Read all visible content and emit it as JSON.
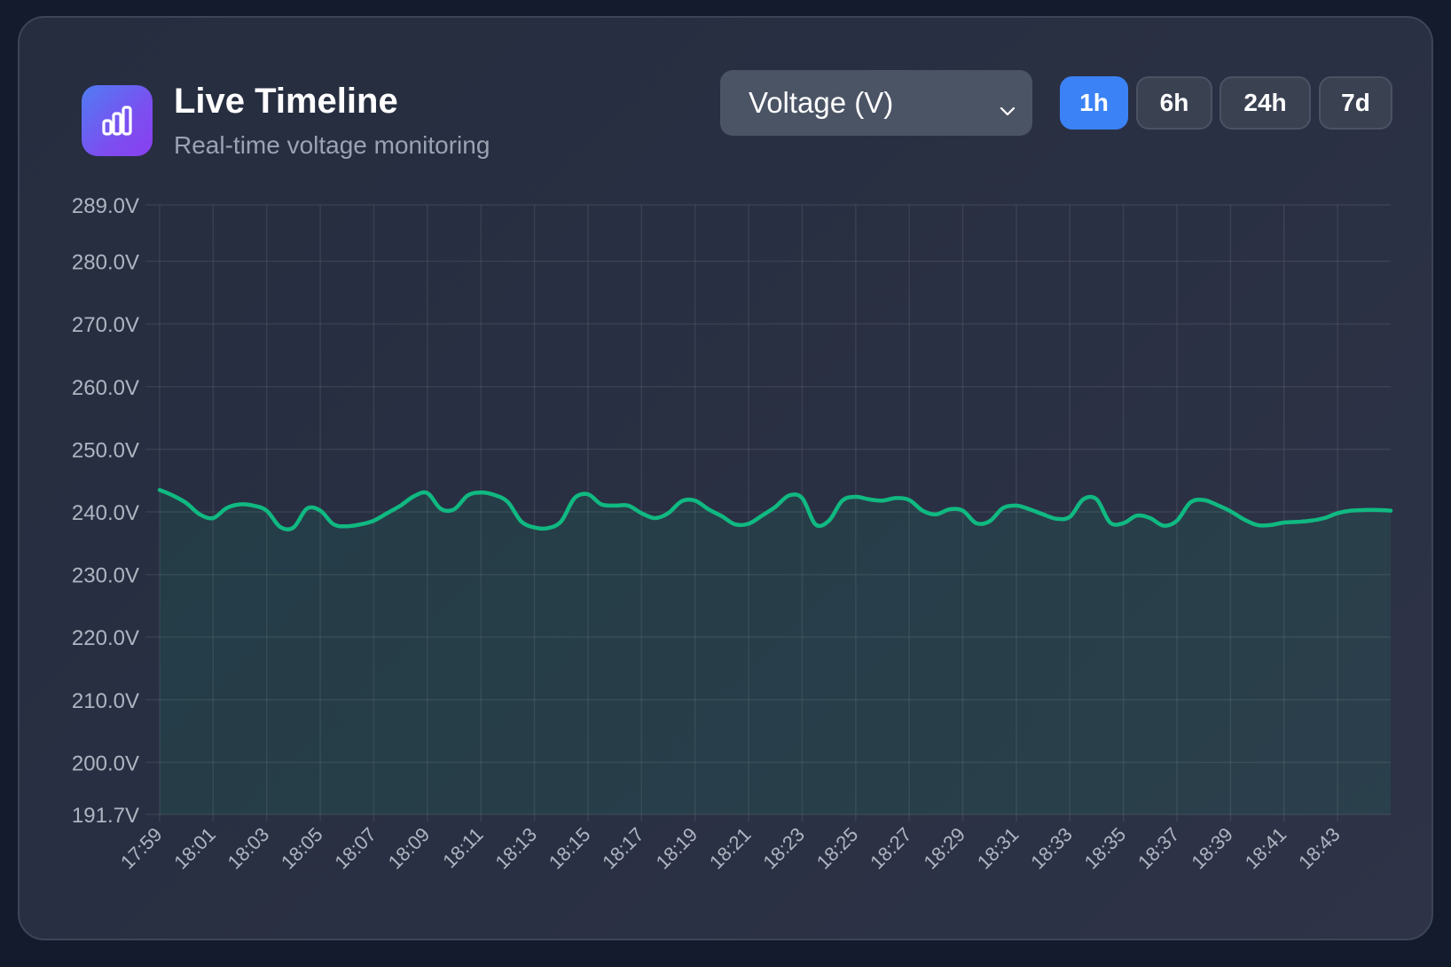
{
  "header": {
    "title": "Live Timeline",
    "subtitle": "Real-time voltage monitoring",
    "icon": "bar-chart-icon"
  },
  "metric_select": {
    "selected": "Voltage (V)"
  },
  "time_ranges": [
    {
      "label": "1h",
      "active": true
    },
    {
      "label": "6h",
      "active": false
    },
    {
      "label": "24h",
      "active": false
    },
    {
      "label": "7d",
      "active": false
    }
  ],
  "colors": {
    "accent": "#3b82f6",
    "line": "#10b981",
    "icon_gradient_start": "#4f7df3",
    "icon_gradient_end": "#8a3ff0"
  },
  "chart_data": {
    "type": "area",
    "title": "",
    "xlabel": "",
    "ylabel": "",
    "grid": true,
    "ylim": [
      191.7,
      289.0
    ],
    "y_ticks": [
      {
        "value": 289.0,
        "label": "289.0V"
      },
      {
        "value": 280.0,
        "label": "280.0V"
      },
      {
        "value": 270.0,
        "label": "270.0V"
      },
      {
        "value": 260.0,
        "label": "260.0V"
      },
      {
        "value": 250.0,
        "label": "250.0V"
      },
      {
        "value": 240.0,
        "label": "240.0V"
      },
      {
        "value": 230.0,
        "label": "230.0V"
      },
      {
        "value": 220.0,
        "label": "220.0V"
      },
      {
        "value": 210.0,
        "label": "210.0V"
      },
      {
        "value": 200.0,
        "label": "200.0V"
      },
      {
        "value": 191.7,
        "label": "191.7V"
      }
    ],
    "x_tick_labels": [
      "17:59",
      "18:01",
      "18:03",
      "18:05",
      "18:07",
      "18:09",
      "18:11",
      "18:13",
      "18:15",
      "18:17",
      "18:19",
      "18:21",
      "18:23",
      "18:25",
      "18:27",
      "18:29",
      "18:31",
      "18:33",
      "18:35",
      "18:37",
      "18:39",
      "18:41",
      "18:43"
    ],
    "series": [
      {
        "x": [
          "17:59",
          "17:59:30",
          "18:00",
          "18:00:30",
          "18:01",
          "18:01:30",
          "18:02",
          "18:02:30",
          "18:03",
          "18:03:30",
          "18:04",
          "18:04:30",
          "18:05",
          "18:05:30",
          "18:06",
          "18:06:30",
          "18:07",
          "18:07:30",
          "18:08",
          "18:08:30",
          "18:09",
          "18:09:30",
          "18:10",
          "18:10:30",
          "18:11",
          "18:11:30",
          "18:12",
          "18:12:30",
          "18:13",
          "18:13:30",
          "18:14",
          "18:14:30",
          "18:15",
          "18:15:30",
          "18:16",
          "18:16:30",
          "18:17",
          "18:17:30",
          "18:18",
          "18:18:30",
          "18:19",
          "18:19:30",
          "18:20",
          "18:20:30",
          "18:21",
          "18:21:30",
          "18:22",
          "18:22:30",
          "18:23",
          "18:23:30",
          "18:24",
          "18:24:30",
          "18:25",
          "18:25:30",
          "18:26",
          "18:26:30",
          "18:27",
          "18:27:30",
          "18:28",
          "18:28:30",
          "18:29",
          "18:29:30",
          "18:30",
          "18:30:30",
          "18:31",
          "18:31:30",
          "18:32",
          "18:32:30",
          "18:33",
          "18:33:30",
          "18:34",
          "18:34:30",
          "18:35",
          "18:35:30",
          "18:36",
          "18:36:30",
          "18:37",
          "18:37:30",
          "18:38",
          "18:38:30",
          "18:39",
          "18:39:30",
          "18:40",
          "18:40:30",
          "18:41",
          "18:41:30",
          "18:42",
          "18:42:30",
          "18:43",
          "18:43:30",
          "18:44",
          "18:44:30",
          "18:44:59"
        ],
        "values": [
          243.5,
          242.6,
          241.4,
          239.6,
          239.0,
          240.6,
          241.2,
          241.0,
          240.2,
          237.6,
          237.5,
          240.5,
          240.2,
          238.0,
          237.7,
          238.0,
          238.6,
          239.8,
          241.0,
          242.5,
          243.0,
          240.5,
          240.4,
          242.6,
          243.1,
          242.7,
          241.6,
          238.5,
          237.5,
          237.4,
          238.5,
          242.2,
          242.8,
          241.2,
          241.0,
          241.0,
          239.8,
          239.0,
          239.8,
          241.7,
          241.8,
          240.4,
          239.3,
          238.0,
          238.1,
          239.4,
          240.8,
          242.6,
          242.2,
          238.0,
          238.6,
          241.8,
          242.4,
          242.0,
          241.8,
          242.2,
          241.9,
          240.2,
          239.6,
          240.4,
          240.2,
          238.2,
          238.5,
          240.6,
          241.0,
          240.4,
          239.6,
          238.9,
          239.2,
          242.0,
          242.0,
          238.3,
          238.2,
          239.4,
          239.0,
          237.8,
          238.6,
          241.5,
          241.9,
          241.1,
          240.1,
          238.8,
          237.9,
          237.9,
          238.3,
          238.4,
          238.6,
          239.0,
          239.8,
          240.2,
          240.3,
          240.3,
          240.2
        ]
      }
    ]
  }
}
